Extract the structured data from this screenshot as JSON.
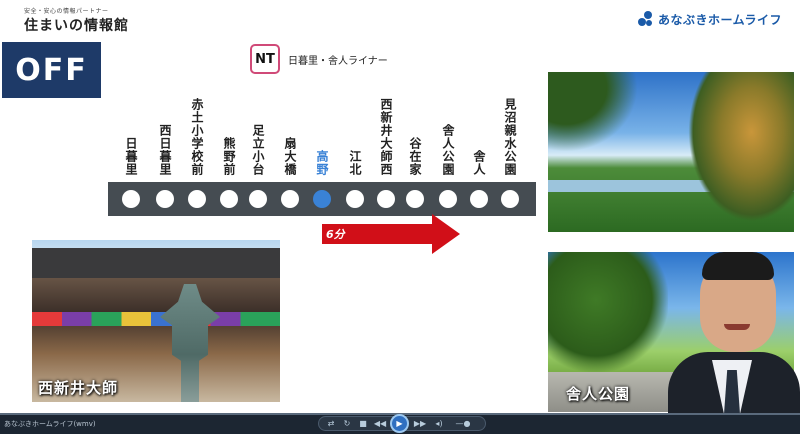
{
  "header": {
    "tagline": "安全・安心の情報パートナー",
    "site_name": "住まいの情報館",
    "brand": "あなぶきホームライフ"
  },
  "badge": {
    "label": "OFF"
  },
  "route": {
    "line_code": "NT",
    "line_name": "日暮里・舎人ライナー",
    "line_color": "#d04a78",
    "stations": [
      {
        "name": "日暮里",
        "active": false
      },
      {
        "name": "西日暮里",
        "active": false
      },
      {
        "name": "赤土小学校前",
        "active": false
      },
      {
        "name": "熊野前",
        "active": false
      },
      {
        "name": "足立小台",
        "active": false
      },
      {
        "name": "扇大橋",
        "active": false
      },
      {
        "name": "高野",
        "active": true
      },
      {
        "name": "江北",
        "active": false
      },
      {
        "name": "西新井大師西",
        "active": false
      },
      {
        "name": "谷在家",
        "active": false
      },
      {
        "name": "舎人公園",
        "active": false
      },
      {
        "name": "舎人",
        "active": false
      },
      {
        "name": "見沼親水公園",
        "active": false
      }
    ],
    "travel_time": "6分",
    "active_color": "#3a82d6",
    "arrow_color": "#d10f18"
  },
  "photos": {
    "temple_caption": "西新井大師",
    "park_caption": "舎人公園"
  },
  "player": {
    "source_label": "あなぶきホームライフ(wmv)"
  }
}
